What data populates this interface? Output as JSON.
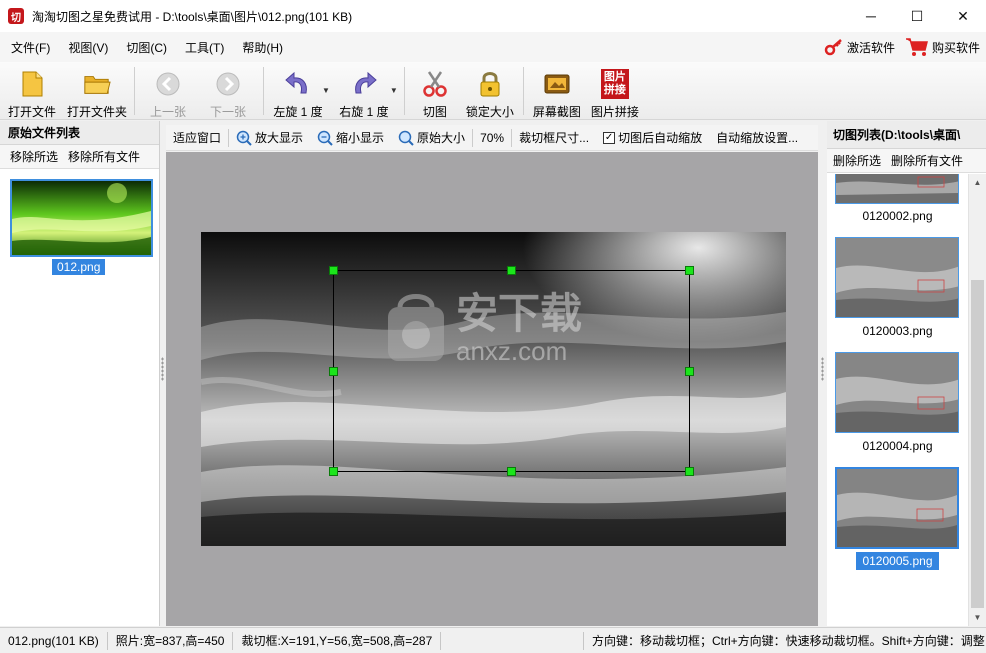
{
  "window": {
    "title": "淘淘切图之星免费试用 - D:\\tools\\桌面\\图片\\012.png(101 KB)",
    "app_icon_text": "切",
    "minimize": "─",
    "maximize": "☐",
    "close": "✕"
  },
  "menu": {
    "items": [
      "文件(F)",
      "视图(V)",
      "切图(C)",
      "工具(T)",
      "帮助(H)"
    ],
    "activate": "激活软件",
    "buy": "购买软件"
  },
  "toolbar": {
    "open_file": "打开文件",
    "open_folder": "打开文件夹",
    "prev": "上一张",
    "next": "下一张",
    "rotate_left": "左旋 1 度",
    "rotate_right": "右旋 1 度",
    "cut": "切图",
    "lock_size": "锁定大小",
    "screen_capture": "屏幕截图",
    "stitch": "图片拼接",
    "stitch_icon_text": "图片\n拼接"
  },
  "left_panel": {
    "title": "原始文件列表",
    "remove_selected": "移除所选",
    "remove_all": "移除所有文件",
    "files": [
      "012.png"
    ]
  },
  "center_toolbar": {
    "fit_window": "适应窗口",
    "zoom_in": "放大显示",
    "zoom_out": "缩小显示",
    "original_size": "原始大小",
    "zoom_level": "70%",
    "crop_size": "裁切框尺寸...",
    "auto_zoom_after_cut": "切图后自动缩放",
    "auto_zoom_checked": true,
    "auto_zoom_settings": "自动缩放设置..."
  },
  "watermark": {
    "main": "安下载",
    "sub": "anxz.com"
  },
  "right_panel": {
    "title": "切图列表(D:\\tools\\桌面\\",
    "remove_selected": "删除所选",
    "remove_all": "删除所有文件",
    "files": [
      "0120002.png",
      "0120003.png",
      "0120004.png",
      "0120005.png"
    ],
    "selected_index": 3
  },
  "statusbar": {
    "file": "012.png(101 KB)",
    "photo": "照片:宽=837,高=450",
    "crop": "裁切框:X=191,Y=56,宽=508,高=287",
    "hint": "方向键：移动裁切框；Ctrl+方向键：快速移动裁切框。Shift+方向键：调整"
  },
  "colors": {
    "selection": "#3385e0",
    "handle": "#1be51b",
    "canvas_bg": "#a6a5a7"
  }
}
